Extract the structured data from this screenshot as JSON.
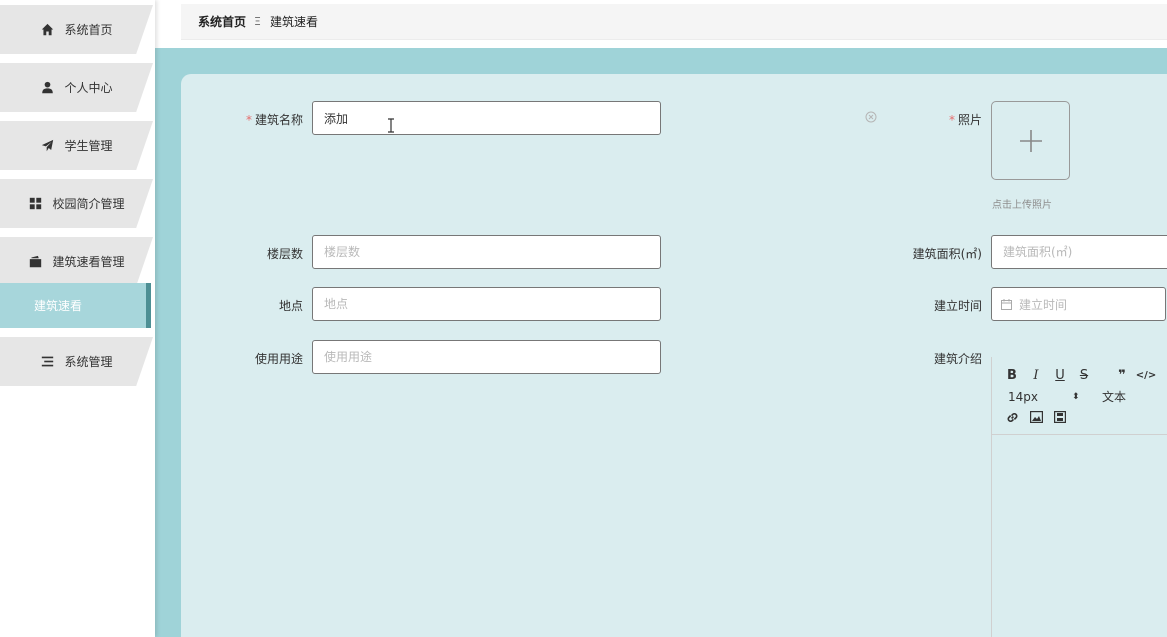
{
  "sidebar": {
    "items": [
      {
        "label": "系统首页",
        "icon": "home-icon"
      },
      {
        "label": "个人中心",
        "icon": "user-icon"
      },
      {
        "label": "学生管理",
        "icon": "send-icon"
      },
      {
        "label": "校园简介管理",
        "icon": "grid-icon"
      },
      {
        "label": "建筑速看管理",
        "icon": "wallet-icon"
      },
      {
        "label": "系统管理",
        "icon": "list-icon"
      }
    ],
    "active_sub": "建筑速看"
  },
  "breadcrumb": {
    "home": "系统首页",
    "separator": "Ξ",
    "current": "建筑速看"
  },
  "form": {
    "name_label": "建筑名称",
    "name_value": "添加",
    "photo_label": "照片",
    "upload_tip": "点击上传照片",
    "floors_label": "楼层数",
    "floors_placeholder": "楼层数",
    "area_label": "建筑面积(㎡)",
    "area_placeholder": "建筑面积(㎡)",
    "location_label": "地点",
    "location_placeholder": "地点",
    "time_label": "建立时间",
    "time_placeholder": "建立时间",
    "usage_label": "使用用途",
    "usage_placeholder": "使用用途",
    "intro_label": "建筑介绍"
  },
  "editor": {
    "bold": "B",
    "italic": "I",
    "underline": "U",
    "strike": "S",
    "quote": "❞",
    "code": "</>",
    "font_size": "14px",
    "text_format": "文本"
  },
  "colors": {
    "accent": "#9fd3d8",
    "panel": "#daedef",
    "active_nav": "#a7d6db",
    "required": "#e56d6d"
  }
}
